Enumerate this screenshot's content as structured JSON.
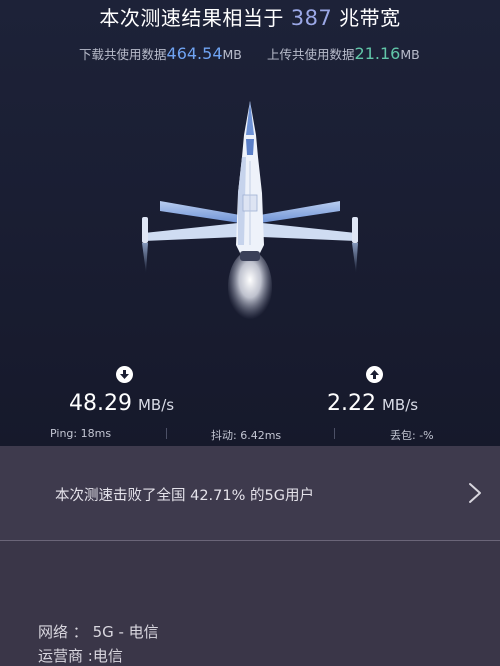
{
  "header": {
    "prefix": "本次测速结果相当于",
    "bandwidth": "387",
    "suffix": "兆带宽"
  },
  "usage": {
    "download_label": "下载共使用数据",
    "download_value": "464.54",
    "download_unit": "MB",
    "upload_label": "上传共使用数据",
    "upload_value": "21.16",
    "upload_unit": "MB"
  },
  "speed": {
    "download_value": "48.29",
    "download_unit": "MB/s",
    "upload_value": "2.22",
    "upload_unit": "MB/s"
  },
  "stats": {
    "ping": "Ping:  18ms",
    "jitter": "抖动:  6.42ms",
    "loss": "丢包:  -%"
  },
  "result": {
    "text": "本次测速击败了全国 42.71% 的5G用户"
  },
  "network": {
    "network_label": "网络 ：",
    "network_value": "5G - 电信",
    "operator_label": "运营商 :",
    "operator_value": "电信"
  },
  "colors": {
    "bandwidth_accent": "#9ba8e6",
    "download_accent": "#6fa3f2",
    "upload_accent": "#61c6a8",
    "icons": [
      "down-arrow-icon",
      "up-arrow-icon",
      "chevron-right-icon",
      "jet-illustration"
    ]
  }
}
